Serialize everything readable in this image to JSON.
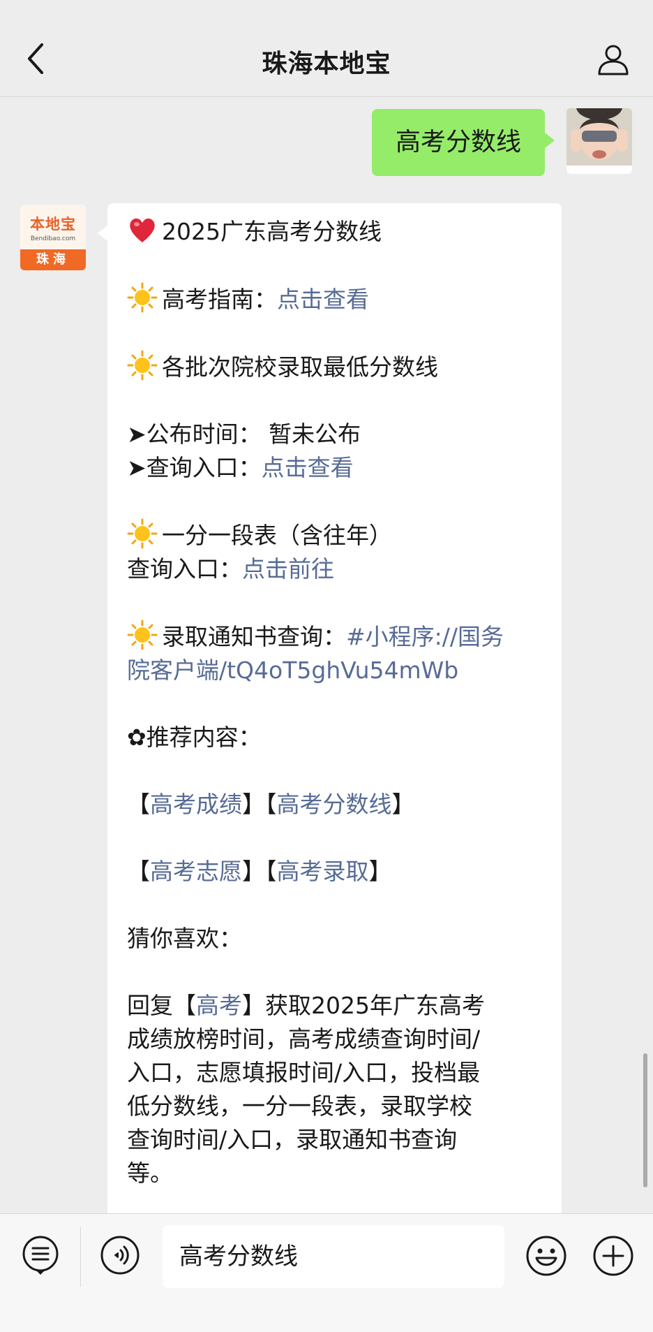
{
  "header": {
    "title": "珠海本地宝"
  },
  "user_message": {
    "text": "高考分数线"
  },
  "bot_avatar": {
    "logo_text": "本地宝",
    "logo_domain": "Bendibao.com",
    "city": "珠海"
  },
  "reply": {
    "title": "2025广东高考分数线",
    "guide_label": "高考指南：",
    "guide_link": "点击查看",
    "batch_title": "各批次院校录取最低分数线",
    "publish_label": "➤公布时间：",
    "publish_value": "暂未公布",
    "query_label": "➤查询入口：",
    "query_link": "点击查看",
    "segment_title": "一分一段表（含往年）",
    "segment_label": "查询入口：",
    "segment_link": "点击前往",
    "notice_label": "录取通知书查询：",
    "notice_link_1": "#小程序://国务",
    "notice_link_2": "院客户端/tQ4oT5ghVu54mWb",
    "recommend_label": "✿推荐内容：",
    "rec_1": "高考成绩",
    "rec_2": "高考分数线",
    "rec_3": "高考志愿",
    "rec_4": "高考录取",
    "guess_label": "猜你喜欢：",
    "reply_prefix": "回复【",
    "reply_keyword": "高考",
    "reply_line_1": "】获取2025年广东高考",
    "reply_line_2": "成绩放榜时间，高考成绩查询时间/",
    "reply_line_3": "入口，志愿填报时间/入口，投档最",
    "reply_line_4": "低分数线，一分一段表，录取学校",
    "reply_line_5": "查询时间/入口，录取通知书查询",
    "reply_line_6": "等。"
  },
  "input_bar": {
    "text": "高考分数线"
  },
  "icons": {
    "back": "chevron-left-icon",
    "profile": "person-icon",
    "menu": "menu-list-icon",
    "voice": "voice-icon",
    "emoji": "smiley-icon",
    "plus": "plus-icon",
    "heart": "heart-icon",
    "sun": "sun-icon"
  },
  "colors": {
    "link": "#576b95",
    "my_bubble": "#95ec69",
    "brand": "#f06a26"
  }
}
